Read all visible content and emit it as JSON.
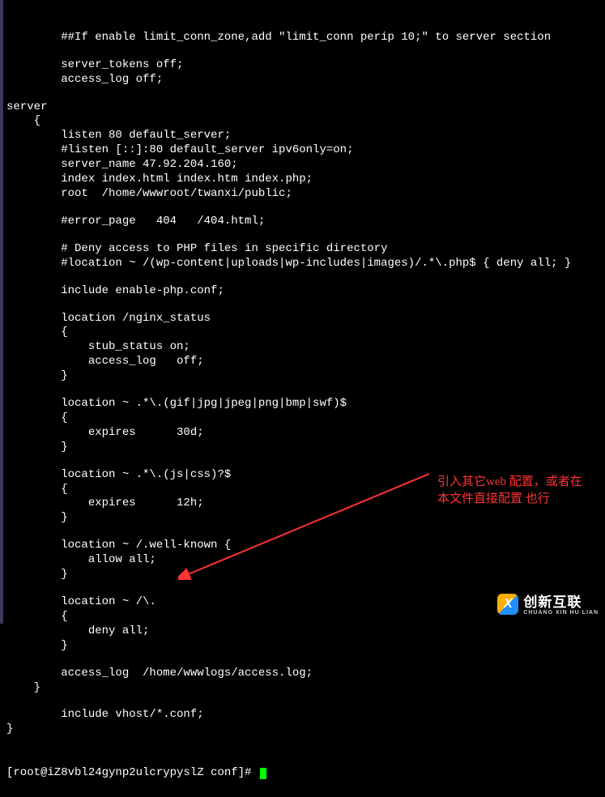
{
  "config_lines": [
    "        ##If enable limit_conn_zone,add \"limit_conn perip 10;\" to server section",
    "",
    "        server_tokens off;",
    "        access_log off;",
    "",
    "server",
    "    {",
    "        listen 80 default_server;",
    "        #listen [::]:80 default_server ipv6only=on;",
    "        server_name 47.92.204.160;",
    "        index index.html index.htm index.php;",
    "        root  /home/wwwroot/twanxi/public;",
    "",
    "        #error_page   404   /404.html;",
    "",
    "        # Deny access to PHP files in specific directory",
    "        #location ~ /(wp-content|uploads|wp-includes|images)/.*\\.php$ { deny all; }",
    "",
    "        include enable-php.conf;",
    "",
    "        location /nginx_status",
    "        {",
    "            stub_status on;",
    "            access_log   off;",
    "        }",
    "",
    "        location ~ .*\\.(gif|jpg|jpeg|png|bmp|swf)$",
    "        {",
    "            expires      30d;",
    "        }",
    "",
    "        location ~ .*\\.(js|css)?$",
    "        {",
    "            expires      12h;",
    "        }",
    "",
    "        location ~ /.well-known {",
    "            allow all;",
    "        }",
    "",
    "        location ~ /\\.",
    "        {",
    "            deny all;",
    "        }",
    "",
    "        access_log  /home/wwwlogs/access.log;",
    "    }",
    "",
    "        include vhost/*.conf;",
    "}"
  ],
  "prompt": "[root@iZ8vbl24gynp2ulcrypyslZ conf]# ",
  "annotation": {
    "line1": "引入其它web 配置，或者在",
    "line2": "本文件直接配置 也行"
  },
  "watermark": {
    "main": "创新互联",
    "sub": "CHUANG XIN HU LIAN",
    "icon_text": "X"
  }
}
